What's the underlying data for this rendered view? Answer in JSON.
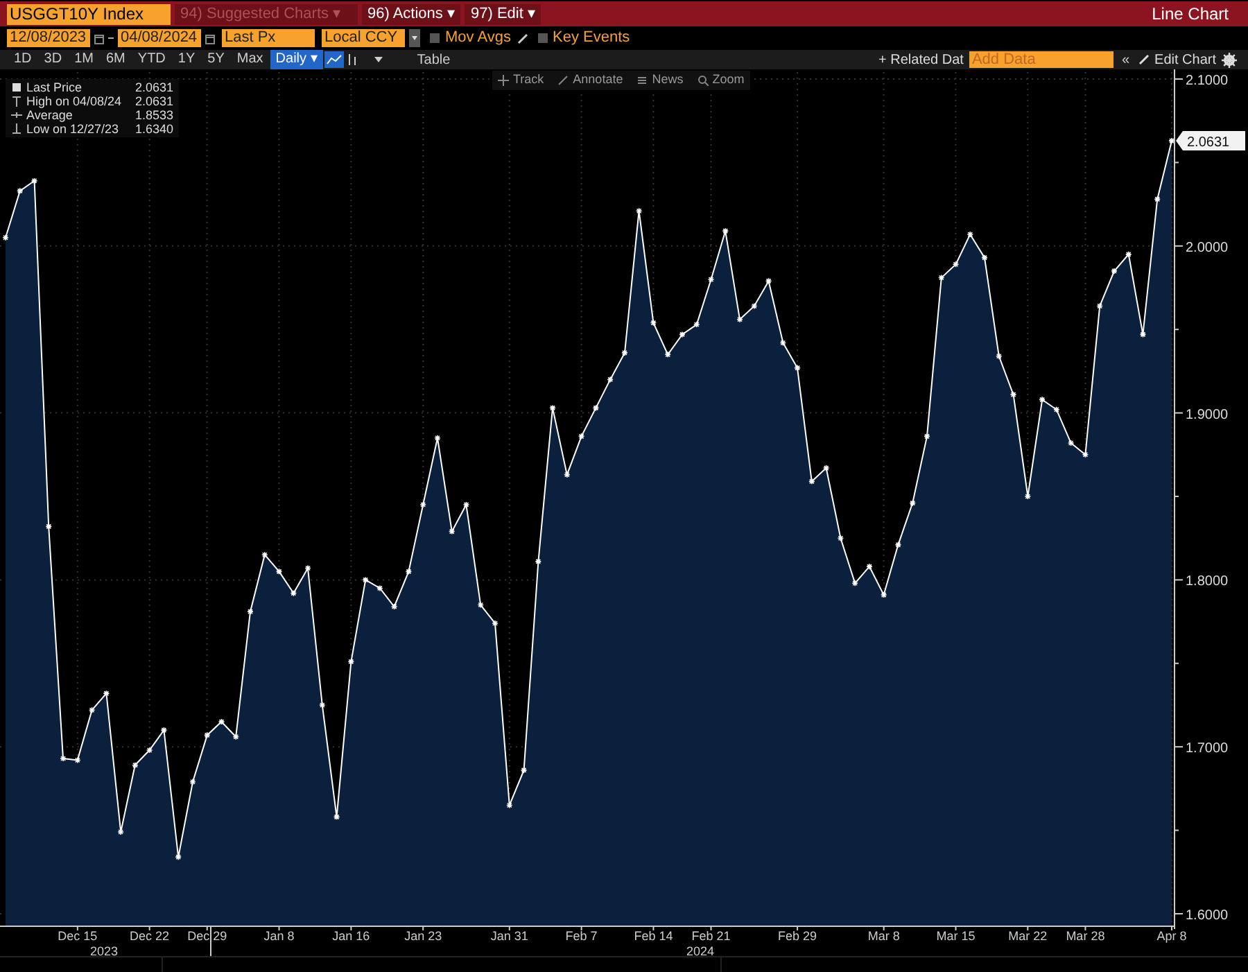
{
  "header": {
    "security": "USGGT10Y Index",
    "menus": [
      {
        "label": "94) Suggested Charts ▾",
        "disabled": true
      },
      {
        "label": "96) Actions ▾",
        "disabled": false
      },
      {
        "label": "97) Edit ▾",
        "disabled": false
      }
    ],
    "view": "Line Chart"
  },
  "controls": {
    "start_date": "12/08/2023",
    "end_date": "04/08/2024",
    "field": "Last Px",
    "currency": "Local CCY",
    "options": [
      {
        "label": "Mov Avgs",
        "checked": false,
        "kind": "edit"
      },
      {
        "label": "Key Events",
        "checked": false,
        "kind": "plain"
      }
    ]
  },
  "periods": [
    {
      "label": "1D",
      "selected": false
    },
    {
      "label": "3D",
      "selected": false
    },
    {
      "label": "1M",
      "selected": false
    },
    {
      "label": "6M",
      "selected": false
    },
    {
      "label": "YTD",
      "selected": false
    },
    {
      "label": "1Y",
      "selected": false
    },
    {
      "label": "5Y",
      "selected": false
    },
    {
      "label": "Max",
      "selected": false
    },
    {
      "label": "Daily ▾",
      "selected": true
    }
  ],
  "table_button": "Table",
  "related_data": "+ Related Dat",
  "add_data": {
    "placeholder": "Add Data"
  },
  "collapse": "«",
  "edit_chart": "Edit Chart",
  "chart_tools": [
    "Track",
    "Annotate",
    "News",
    "Zoom"
  ],
  "legend": [
    {
      "kind": "last",
      "label": "Last Price",
      "value": "2.0631"
    },
    {
      "kind": "high",
      "label": "High on 04/08/24",
      "value": "2.0631"
    },
    {
      "kind": "average",
      "label": "Average",
      "value": "1.8533"
    },
    {
      "kind": "low",
      "label": "Low on 12/27/23",
      "value": "1.6340"
    }
  ],
  "last_label": "2.0631",
  "years": [
    "2023",
    "2024"
  ],
  "chart_data": {
    "type": "area",
    "grid": true,
    "ylim": [
      1.6,
      2.1
    ],
    "yticks": [
      {
        "value": 1.6,
        "label": "1.6000"
      },
      {
        "value": 1.7,
        "label": "1.7000"
      },
      {
        "value": 1.8,
        "label": "1.8000"
      },
      {
        "value": 1.9,
        "label": "1.9000"
      },
      {
        "value": 2.0,
        "label": "2.0000"
      },
      {
        "value": 2.1,
        "label": "2.1000"
      }
    ],
    "categories": [
      null,
      null,
      null,
      null,
      null,
      "Dec 15",
      null,
      null,
      null,
      null,
      "Dec 22",
      null,
      null,
      null,
      "Dec 29",
      null,
      null,
      null,
      null,
      "Jan 8",
      null,
      null,
      null,
      null,
      "Jan 16",
      null,
      null,
      null,
      null,
      "Jan 23",
      null,
      null,
      null,
      null,
      null,
      "Jan 31",
      null,
      null,
      null,
      null,
      "Feb 7",
      null,
      null,
      null,
      null,
      "Feb 14",
      null,
      null,
      null,
      "Feb 21",
      null,
      null,
      null,
      null,
      null,
      "Feb 29",
      null,
      null,
      null,
      null,
      null,
      "Mar 8",
      null,
      null,
      null,
      null,
      "Mar 15",
      null,
      null,
      null,
      null,
      "Mar 22",
      null,
      null,
      null,
      "Mar 28",
      null,
      null,
      null,
      null,
      null,
      "Apr 8"
    ],
    "series": [
      {
        "color": "#ffffff",
        "values": [
          2.005,
          2.033,
          2.039,
          1.832,
          1.693,
          1.692,
          1.722,
          1.732,
          1.649,
          1.689,
          1.698,
          1.71,
          1.634,
          1.679,
          1.707,
          1.715,
          1.706,
          1.781,
          1.815,
          1.805,
          1.792,
          1.807,
          1.725,
          1.658,
          1.751,
          1.8,
          1.795,
          1.784,
          1.805,
          1.845,
          1.885,
          1.829,
          1.845,
          1.785,
          1.774,
          1.665,
          1.686,
          1.811,
          1.903,
          1.863,
          1.886,
          1.903,
          1.92,
          1.936,
          2.021,
          1.954,
          1.935,
          1.947,
          1.953,
          1.98,
          2.009,
          1.956,
          1.964,
          1.979,
          1.942,
          1.927,
          1.859,
          1.867,
          1.825,
          1.798,
          1.808,
          1.791,
          1.821,
          1.846,
          1.886,
          1.981,
          1.989,
          2.007,
          1.993,
          1.934,
          1.911,
          1.85,
          1.908,
          1.902,
          1.882,
          1.875,
          1.964,
          1.985,
          1.995,
          1.947,
          2.028,
          2.063
        ]
      }
    ]
  }
}
